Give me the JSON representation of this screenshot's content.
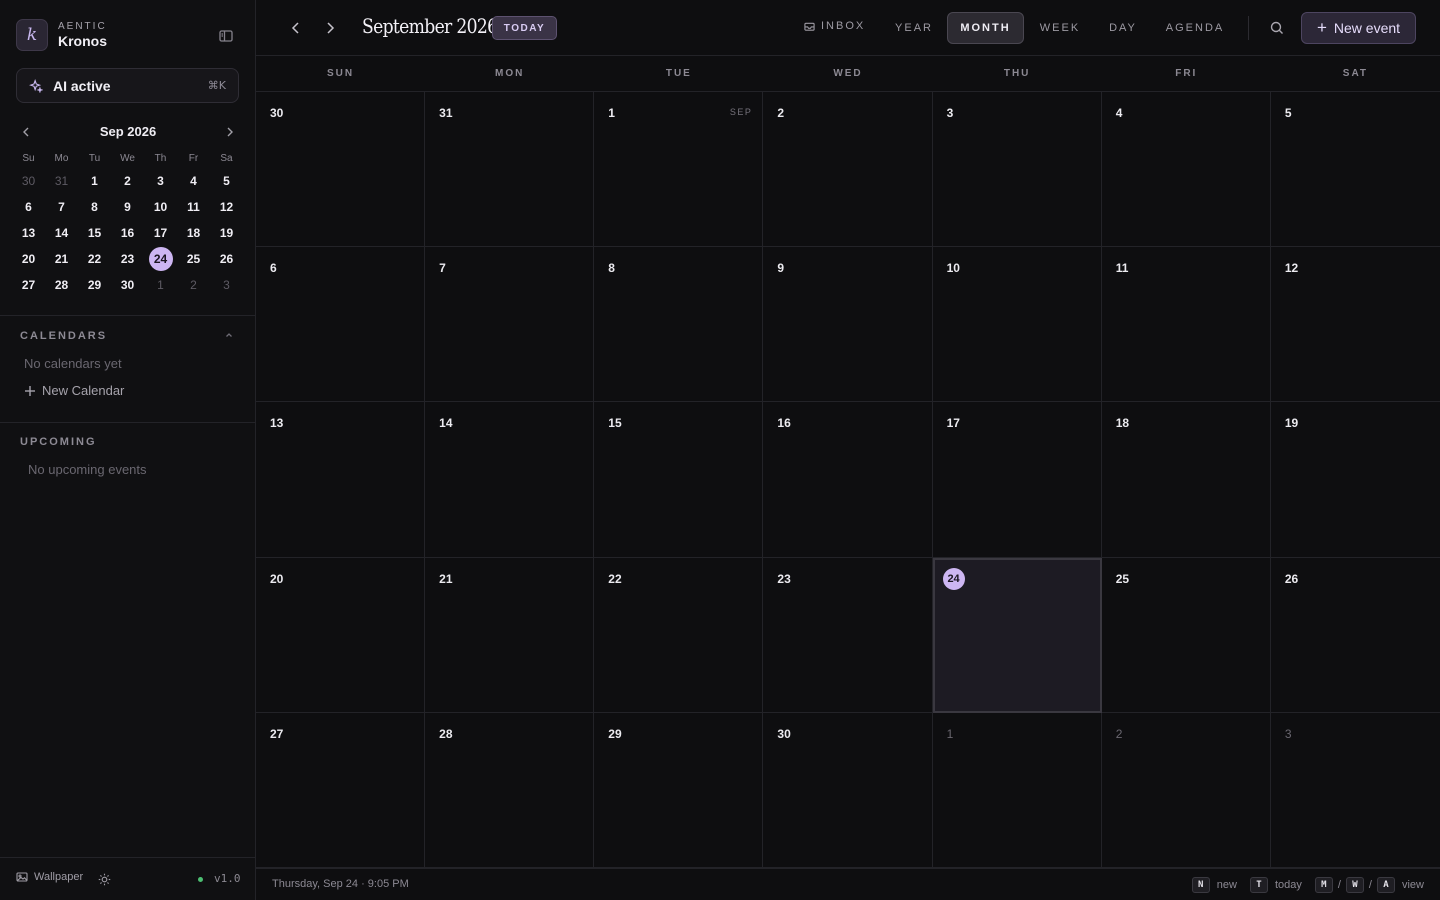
{
  "brand": {
    "logo_letter": "k",
    "sup": "AENTIC",
    "name": "Kronos"
  },
  "ai": {
    "label": "AI active",
    "shortcut": "⌘K"
  },
  "mini_calendar": {
    "title": "Sep 2026",
    "dow": [
      "Su",
      "Mo",
      "Tu",
      "We",
      "Th",
      "Fr",
      "Sa"
    ],
    "days": [
      {
        "d": "30",
        "muted": true
      },
      {
        "d": "31",
        "muted": true
      },
      {
        "d": "1"
      },
      {
        "d": "2"
      },
      {
        "d": "3"
      },
      {
        "d": "4"
      },
      {
        "d": "5"
      },
      {
        "d": "6"
      },
      {
        "d": "7"
      },
      {
        "d": "8"
      },
      {
        "d": "9"
      },
      {
        "d": "10"
      },
      {
        "d": "11"
      },
      {
        "d": "12"
      },
      {
        "d": "13"
      },
      {
        "d": "14"
      },
      {
        "d": "15"
      },
      {
        "d": "16"
      },
      {
        "d": "17"
      },
      {
        "d": "18"
      },
      {
        "d": "19"
      },
      {
        "d": "20"
      },
      {
        "d": "21"
      },
      {
        "d": "22"
      },
      {
        "d": "23"
      },
      {
        "d": "24",
        "selected": true
      },
      {
        "d": "25"
      },
      {
        "d": "26"
      },
      {
        "d": "27"
      },
      {
        "d": "28"
      },
      {
        "d": "29"
      },
      {
        "d": "30"
      },
      {
        "d": "1",
        "muted": true
      },
      {
        "d": "2",
        "muted": true
      },
      {
        "d": "3",
        "muted": true
      }
    ]
  },
  "calendars": {
    "title": "CALENDARS",
    "empty": "No calendars yet",
    "new_label": "New Calendar"
  },
  "upcoming": {
    "title": "UPCOMING",
    "empty": "No upcoming events"
  },
  "sidebar_footer": {
    "wallpaper_label": "Wallpaper",
    "version": "v1.0"
  },
  "topbar": {
    "title": "September 2026",
    "today_label": "TODAY",
    "inbox_label": "INBOX",
    "views": [
      "YEAR",
      "MONTH",
      "WEEK",
      "DAY",
      "AGENDA"
    ],
    "active_view": "MONTH",
    "new_event_label": "New event"
  },
  "month_grid": {
    "dow": [
      "SUN",
      "MON",
      "TUE",
      "WED",
      "THU",
      "FRI",
      "SAT"
    ],
    "cells": [
      {
        "d": "30"
      },
      {
        "d": "31"
      },
      {
        "d": "1",
        "tag": "SEP"
      },
      {
        "d": "2"
      },
      {
        "d": "3"
      },
      {
        "d": "4"
      },
      {
        "d": "5"
      },
      {
        "d": "6"
      },
      {
        "d": "7"
      },
      {
        "d": "8"
      },
      {
        "d": "9"
      },
      {
        "d": "10"
      },
      {
        "d": "11"
      },
      {
        "d": "12"
      },
      {
        "d": "13"
      },
      {
        "d": "14"
      },
      {
        "d": "15"
      },
      {
        "d": "16"
      },
      {
        "d": "17"
      },
      {
        "d": "18"
      },
      {
        "d": "19"
      },
      {
        "d": "20"
      },
      {
        "d": "21"
      },
      {
        "d": "22"
      },
      {
        "d": "23"
      },
      {
        "d": "24",
        "today": true
      },
      {
        "d": "25"
      },
      {
        "d": "26"
      },
      {
        "d": "27"
      },
      {
        "d": "28"
      },
      {
        "d": "29"
      },
      {
        "d": "30"
      },
      {
        "d": "1",
        "muted": true
      },
      {
        "d": "2",
        "muted": true
      },
      {
        "d": "3",
        "muted": true
      }
    ]
  },
  "footer": {
    "now": "Thursday, Sep 24 · 9:05 PM",
    "hints": [
      {
        "keys": [
          "N"
        ],
        "label": "new"
      },
      {
        "keys": [
          "T"
        ],
        "label": "today"
      },
      {
        "keys": [
          "M",
          "W",
          "A"
        ],
        "label": "view"
      }
    ]
  },
  "colors": {
    "accent": "#cdb6f2",
    "background": "#0e0e10",
    "today_cell": "#1d1b23",
    "status_ok": "#4cbf72"
  }
}
